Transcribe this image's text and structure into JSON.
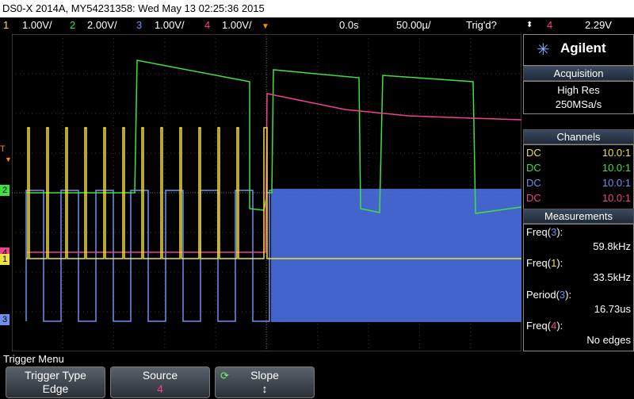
{
  "title_bar": {
    "text": "DS0-X 2014A, MY54231358: Wed May 13 02:25:36 2015"
  },
  "status_bar": {
    "ch1": {
      "num": "1",
      "scale": "1.00V/",
      "color": "#f0e040"
    },
    "ch2": {
      "num": "2",
      "scale": "2.00V/",
      "color": "#40e040"
    },
    "ch3": {
      "num": "3",
      "scale": "1.00V/",
      "color": "#6f8ff0"
    },
    "ch4": {
      "num": "4",
      "scale": "1.00V/",
      "color": "#f04090"
    },
    "time_offset": "0.0s",
    "time_scale": "50.00µ/",
    "trigger_status": "Trig'd?",
    "trigger_source": "4",
    "trigger_level": "2.29V"
  },
  "markers": {
    "ch1": "1",
    "ch2": "2",
    "ch3": "3",
    "ch4": "4",
    "trigger": "T"
  },
  "side_panel": {
    "logo": "Agilent",
    "acquisition": {
      "title": "Acquisition",
      "mode": "High Res",
      "rate": "250MSa/s"
    },
    "channels": {
      "title": "Channels",
      "rows": [
        {
          "coupling": "DC",
          "probe": "10.0:1",
          "color": "#f0e040"
        },
        {
          "coupling": "DC",
          "probe": "10.0:1",
          "color": "#40e040"
        },
        {
          "coupling": "DC",
          "probe": "10.0:1",
          "color": "#6f8ff0"
        },
        {
          "coupling": "DC",
          "probe": "10.0:1",
          "color": "#f04090"
        }
      ]
    },
    "measurements": {
      "title": "Measurements",
      "items": [
        {
          "name": "Freq",
          "ch": "3",
          "value": "59.8kHz"
        },
        {
          "name": "Freq",
          "ch": "1",
          "value": "33.5kHz"
        },
        {
          "name": "Period",
          "ch": "3",
          "value": "16.73us"
        },
        {
          "name": "Freq",
          "ch": "4",
          "value": "No edges"
        }
      ]
    }
  },
  "menu": {
    "title": "Trigger Menu",
    "softkeys": [
      {
        "label": "Trigger Type",
        "value": "Edge"
      },
      {
        "label": "Source",
        "value": "4"
      },
      {
        "label": "Slope",
        "value": "↕"
      }
    ]
  }
}
